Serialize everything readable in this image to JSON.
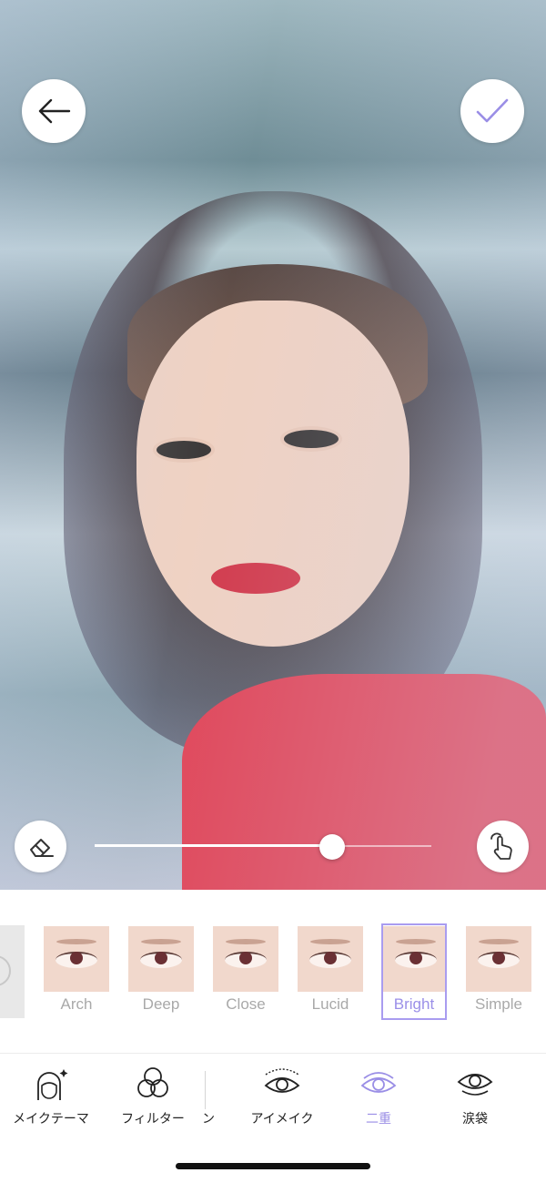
{
  "photo": {
    "subject": "portrait-photo"
  },
  "toolbar": {
    "back_icon": "arrow-left-icon",
    "confirm_icon": "checkmark-icon",
    "accent": "#9a8ee6"
  },
  "adjust": {
    "intensity": 0.705,
    "eraser_icon": "eraser-icon",
    "gesture_icon": "hand-tap-icon"
  },
  "styles": {
    "items": [
      {
        "label": "Arch"
      },
      {
        "label": "Deep"
      },
      {
        "label": "Close"
      },
      {
        "label": "Lucid"
      },
      {
        "label": "Bright",
        "selected": true
      },
      {
        "label": "Simple"
      }
    ]
  },
  "tabs": {
    "items": [
      {
        "label": "メイクテーマ",
        "icon": "makeup-theme-icon"
      },
      {
        "label": "フィルター",
        "icon": "filter-icon"
      },
      {
        "label": "ン",
        "icon": ""
      },
      {
        "label": "アイメイク",
        "icon": "eye-makeup-icon"
      },
      {
        "label": "二重",
        "icon": "double-eyelid-icon",
        "active": true
      },
      {
        "label": "涙袋",
        "icon": "eye-bag-icon"
      }
    ]
  }
}
